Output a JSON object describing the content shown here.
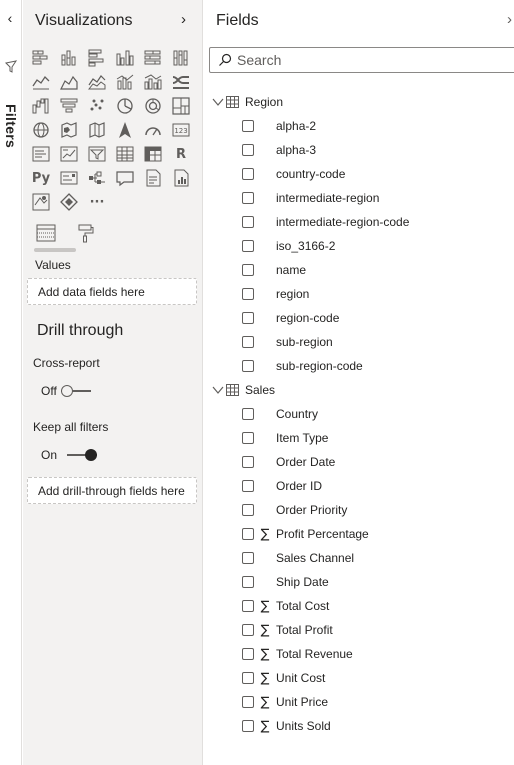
{
  "filters": {
    "label": "Filters"
  },
  "visualizations": {
    "title": "Visualizations",
    "icon_rows": [
      [
        "stacked-bar-chart-icon",
        "stacked-column-chart-icon",
        "clustered-bar-chart-icon",
        "clustered-column-chart-icon",
        "100-percent-bar-chart-icon",
        "100-percent-column-chart-icon"
      ],
      [
        "line-chart-icon",
        "area-chart-icon",
        "stacked-area-chart-icon",
        "line-and-column-chart-icon",
        "line-and-clustered-column-chart-icon",
        "ribbon-chart-icon"
      ],
      [
        "waterfall-chart-icon",
        "funnel-chart-icon",
        "scatter-chart-icon",
        "pie-chart-icon",
        "donut-chart-icon",
        "treemap-icon"
      ],
      [
        "map-icon",
        "filled-map-icon",
        "shape-map-icon",
        "azure-map-icon",
        "gauge-icon",
        "card-icon"
      ],
      [
        "multi-row-card-icon",
        "kpi-icon",
        "slicer-icon",
        "table-icon",
        "matrix-icon",
        "r-visual-icon"
      ],
      [
        "python-visual-icon",
        "key-influencers-icon",
        "decomposition-tree-icon",
        "qa-icon",
        "smart-narrative-icon",
        "paginated-report-icon"
      ],
      [
        "arcgis-map-icon",
        "power-apps-icon",
        "more-visuals-icon"
      ]
    ],
    "r_glyph": "R",
    "py_glyph": "Py",
    "card_glyph": "123",
    "more_glyph": "···",
    "values_label": "Values",
    "values_placeholder": "Add data fields here",
    "drill_through": {
      "title": "Drill through",
      "cross_report_label": "Cross-report",
      "cross_report_state": "Off",
      "keep_filters_label": "Keep all filters",
      "keep_filters_state": "On",
      "placeholder": "Add drill-through fields here"
    }
  },
  "fields": {
    "title": "Fields",
    "search": {
      "placeholder": "Search"
    },
    "tables": [
      {
        "name": "Region",
        "fields": [
          {
            "name": "alpha-2",
            "measure": false
          },
          {
            "name": "alpha-3",
            "measure": false
          },
          {
            "name": "country-code",
            "measure": false
          },
          {
            "name": "intermediate-region",
            "measure": false
          },
          {
            "name": "intermediate-region-code",
            "measure": false
          },
          {
            "name": "iso_3166-2",
            "measure": false
          },
          {
            "name": "name",
            "measure": false
          },
          {
            "name": "region",
            "measure": false
          },
          {
            "name": "region-code",
            "measure": false
          },
          {
            "name": "sub-region",
            "measure": false
          },
          {
            "name": "sub-region-code",
            "measure": false
          }
        ]
      },
      {
        "name": "Sales",
        "fields": [
          {
            "name": "Country",
            "measure": false
          },
          {
            "name": "Item Type",
            "measure": false
          },
          {
            "name": "Order Date",
            "measure": false
          },
          {
            "name": "Order ID",
            "measure": false
          },
          {
            "name": "Order Priority",
            "measure": false
          },
          {
            "name": "Profit Percentage",
            "measure": true
          },
          {
            "name": "Sales Channel",
            "measure": false
          },
          {
            "name": "Ship Date",
            "measure": false
          },
          {
            "name": "Total Cost",
            "measure": true
          },
          {
            "name": "Total Profit",
            "measure": true
          },
          {
            "name": "Total Revenue",
            "measure": true
          },
          {
            "name": "Unit Cost",
            "measure": true
          },
          {
            "name": "Unit Price",
            "measure": true
          },
          {
            "name": "Units Sold",
            "measure": true
          }
        ]
      }
    ],
    "sigma_glyph": "∑"
  }
}
